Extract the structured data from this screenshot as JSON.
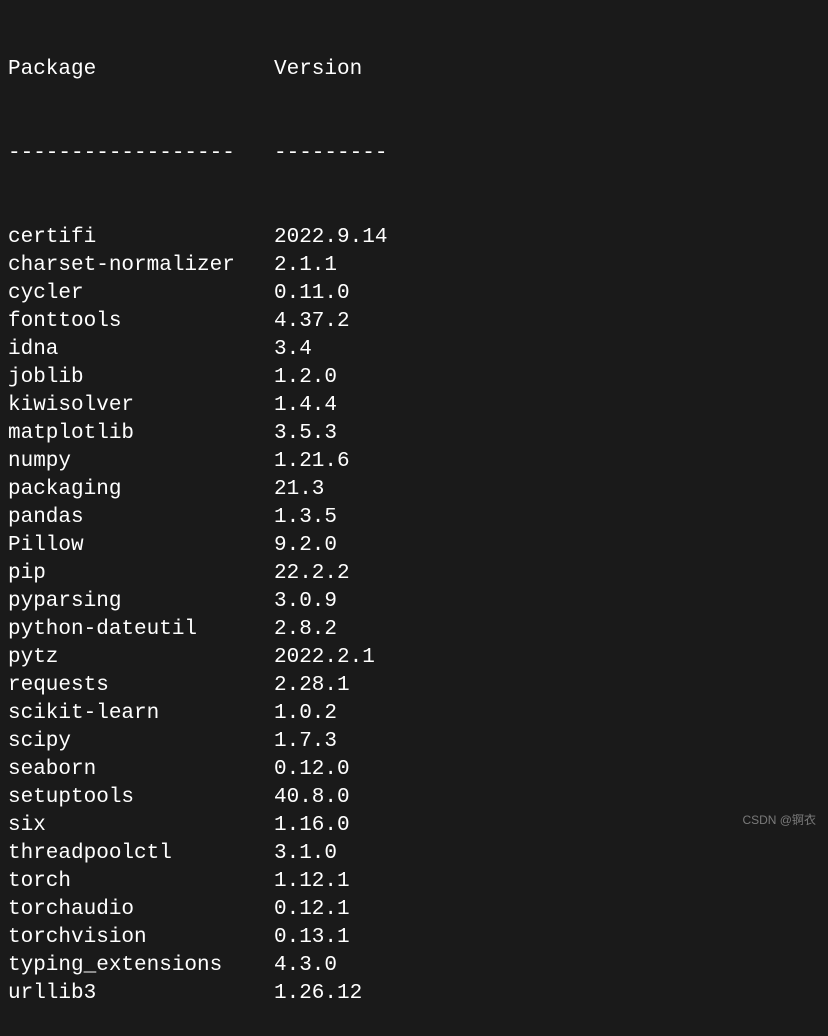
{
  "header": {
    "package_label": "Package",
    "version_label": "Version"
  },
  "separator": {
    "package_sep": "------------------",
    "version_sep": "---------"
  },
  "packages": [
    {
      "name": "certifi",
      "version": "2022.9.14"
    },
    {
      "name": "charset-normalizer",
      "version": "2.1.1"
    },
    {
      "name": "cycler",
      "version": "0.11.0"
    },
    {
      "name": "fonttools",
      "version": "4.37.2"
    },
    {
      "name": "idna",
      "version": "3.4"
    },
    {
      "name": "joblib",
      "version": "1.2.0"
    },
    {
      "name": "kiwisolver",
      "version": "1.4.4"
    },
    {
      "name": "matplotlib",
      "version": "3.5.3"
    },
    {
      "name": "numpy",
      "version": "1.21.6"
    },
    {
      "name": "packaging",
      "version": "21.3"
    },
    {
      "name": "pandas",
      "version": "1.3.5"
    },
    {
      "name": "Pillow",
      "version": "9.2.0"
    },
    {
      "name": "pip",
      "version": "22.2.2"
    },
    {
      "name": "pyparsing",
      "version": "3.0.9"
    },
    {
      "name": "python-dateutil",
      "version": "2.8.2"
    },
    {
      "name": "pytz",
      "version": "2022.2.1"
    },
    {
      "name": "requests",
      "version": "2.28.1"
    },
    {
      "name": "scikit-learn",
      "version": "1.0.2"
    },
    {
      "name": "scipy",
      "version": "1.7.3"
    },
    {
      "name": "seaborn",
      "version": "0.12.0"
    },
    {
      "name": "setuptools",
      "version": "40.8.0"
    },
    {
      "name": "six",
      "version": "1.16.0"
    },
    {
      "name": "threadpoolctl",
      "version": "3.1.0"
    },
    {
      "name": "torch",
      "version": "1.12.1"
    },
    {
      "name": "torchaudio",
      "version": "0.12.1"
    },
    {
      "name": "torchvision",
      "version": "0.13.1"
    },
    {
      "name": "typing_extensions",
      "version": "4.3.0"
    },
    {
      "name": "urllib3",
      "version": "1.26.12"
    }
  ],
  "watermark": "CSDN @锕衣"
}
